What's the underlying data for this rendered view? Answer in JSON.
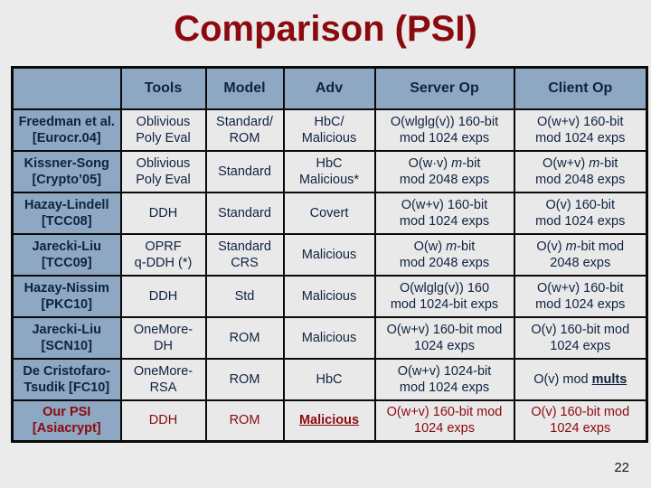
{
  "slide": {
    "title": "Comparison (PSI)",
    "page_number": "22"
  },
  "table": {
    "headers": [
      "",
      "Tools",
      "Model",
      "Adv",
      "Server Op",
      "Client Op"
    ],
    "rows": [
      {
        "label": [
          "Freedman et al.",
          "[Eurocr.04]"
        ],
        "tools": [
          "Oblivious",
          "Poly Eval"
        ],
        "model": [
          "Standard/",
          "ROM"
        ],
        "adv": [
          "HbC/",
          "Malicious"
        ],
        "server": [
          "O(wlglg(v)) 160-bit",
          "mod 1024 exps"
        ],
        "client": [
          "O(w+v) 160-bit",
          "mod 1024 exps"
        ]
      },
      {
        "label": [
          "Kissner-Song",
          "[Crypto’05]"
        ],
        "tools": [
          "Oblivious",
          "Poly Eval"
        ],
        "model": [
          "Standard"
        ],
        "adv": [
          "HbC",
          "Malicious*"
        ],
        "server": [
          {
            "pre": "O(w·v) ",
            "ital": "m",
            "post": "-bit"
          },
          "mod 2048 exps"
        ],
        "client": [
          {
            "pre": "O(w+v) ",
            "ital": "m",
            "post": "-bit"
          },
          "mod 2048 exps"
        ]
      },
      {
        "label": [
          "Hazay-Lindell",
          "[TCC08]"
        ],
        "tools": [
          "DDH"
        ],
        "model": [
          "Standard"
        ],
        "adv": [
          "Covert"
        ],
        "server": [
          "O(w+v) 160-bit",
          "mod 1024 exps"
        ],
        "client": [
          "O(v) 160-bit",
          "mod 1024 exps"
        ]
      },
      {
        "label": [
          "Jarecki-Liu",
          "[TCC09]"
        ],
        "tools": [
          "OPRF",
          "q-DDH (*)"
        ],
        "model": [
          "Standard",
          "CRS"
        ],
        "adv": [
          "Malicious"
        ],
        "server": [
          {
            "pre": "O(w) ",
            "ital": "m",
            "post": "-bit"
          },
          "mod 2048 exps"
        ],
        "client": [
          {
            "pre": "O(v) ",
            "ital": "m",
            "post": "-bit mod"
          },
          "2048 exps"
        ]
      },
      {
        "label": [
          "Hazay-Nissim",
          "[PKC10]"
        ],
        "tools": [
          "DDH"
        ],
        "model": [
          "Std"
        ],
        "adv": [
          "Malicious"
        ],
        "server": [
          "O(wlglg(v)) 160",
          "mod 1024-bit exps"
        ],
        "client": [
          "O(w+v) 160-bit",
          "mod 1024 exps"
        ]
      },
      {
        "label": [
          "Jarecki-Liu",
          "[SCN10]"
        ],
        "tools": [
          "OneMore-",
          "DH"
        ],
        "model": [
          "ROM"
        ],
        "adv": [
          "Malicious"
        ],
        "server": [
          "O(w+v) 160-bit mod",
          "1024 exps"
        ],
        "client": [
          "O(v) 160-bit mod",
          "1024 exps"
        ]
      },
      {
        "label": [
          "De Cristofaro-",
          "Tsudik [FC10]"
        ],
        "tools": [
          "OneMore-",
          "RSA"
        ],
        "model": [
          "ROM"
        ],
        "adv": [
          "HbC"
        ],
        "server": [
          "O(w+v) 1024-bit",
          "mod 1024 exps"
        ],
        "client": [
          {
            "pre": "O(v) mod ",
            "under": "mults"
          }
        ]
      },
      {
        "label": [
          "Our PSI",
          "[Asiacrypt]"
        ],
        "tools": [
          "DDH"
        ],
        "model": [
          "ROM"
        ],
        "adv": [
          {
            "under": "Malicious"
          }
        ],
        "server": [
          "O(w+v) 160-bit mod",
          "1024 exps"
        ],
        "client": [
          "O(v) 160-bit mod",
          "1024 exps"
        ]
      }
    ]
  },
  "colors": {
    "title": "#8b0a0f",
    "header_bg": "#8ea7c2",
    "cell_bg": "#e9e9e9",
    "text_navy": "#0f2340",
    "highlight_text": "#8b0a0f",
    "background": "#ebebeb"
  }
}
